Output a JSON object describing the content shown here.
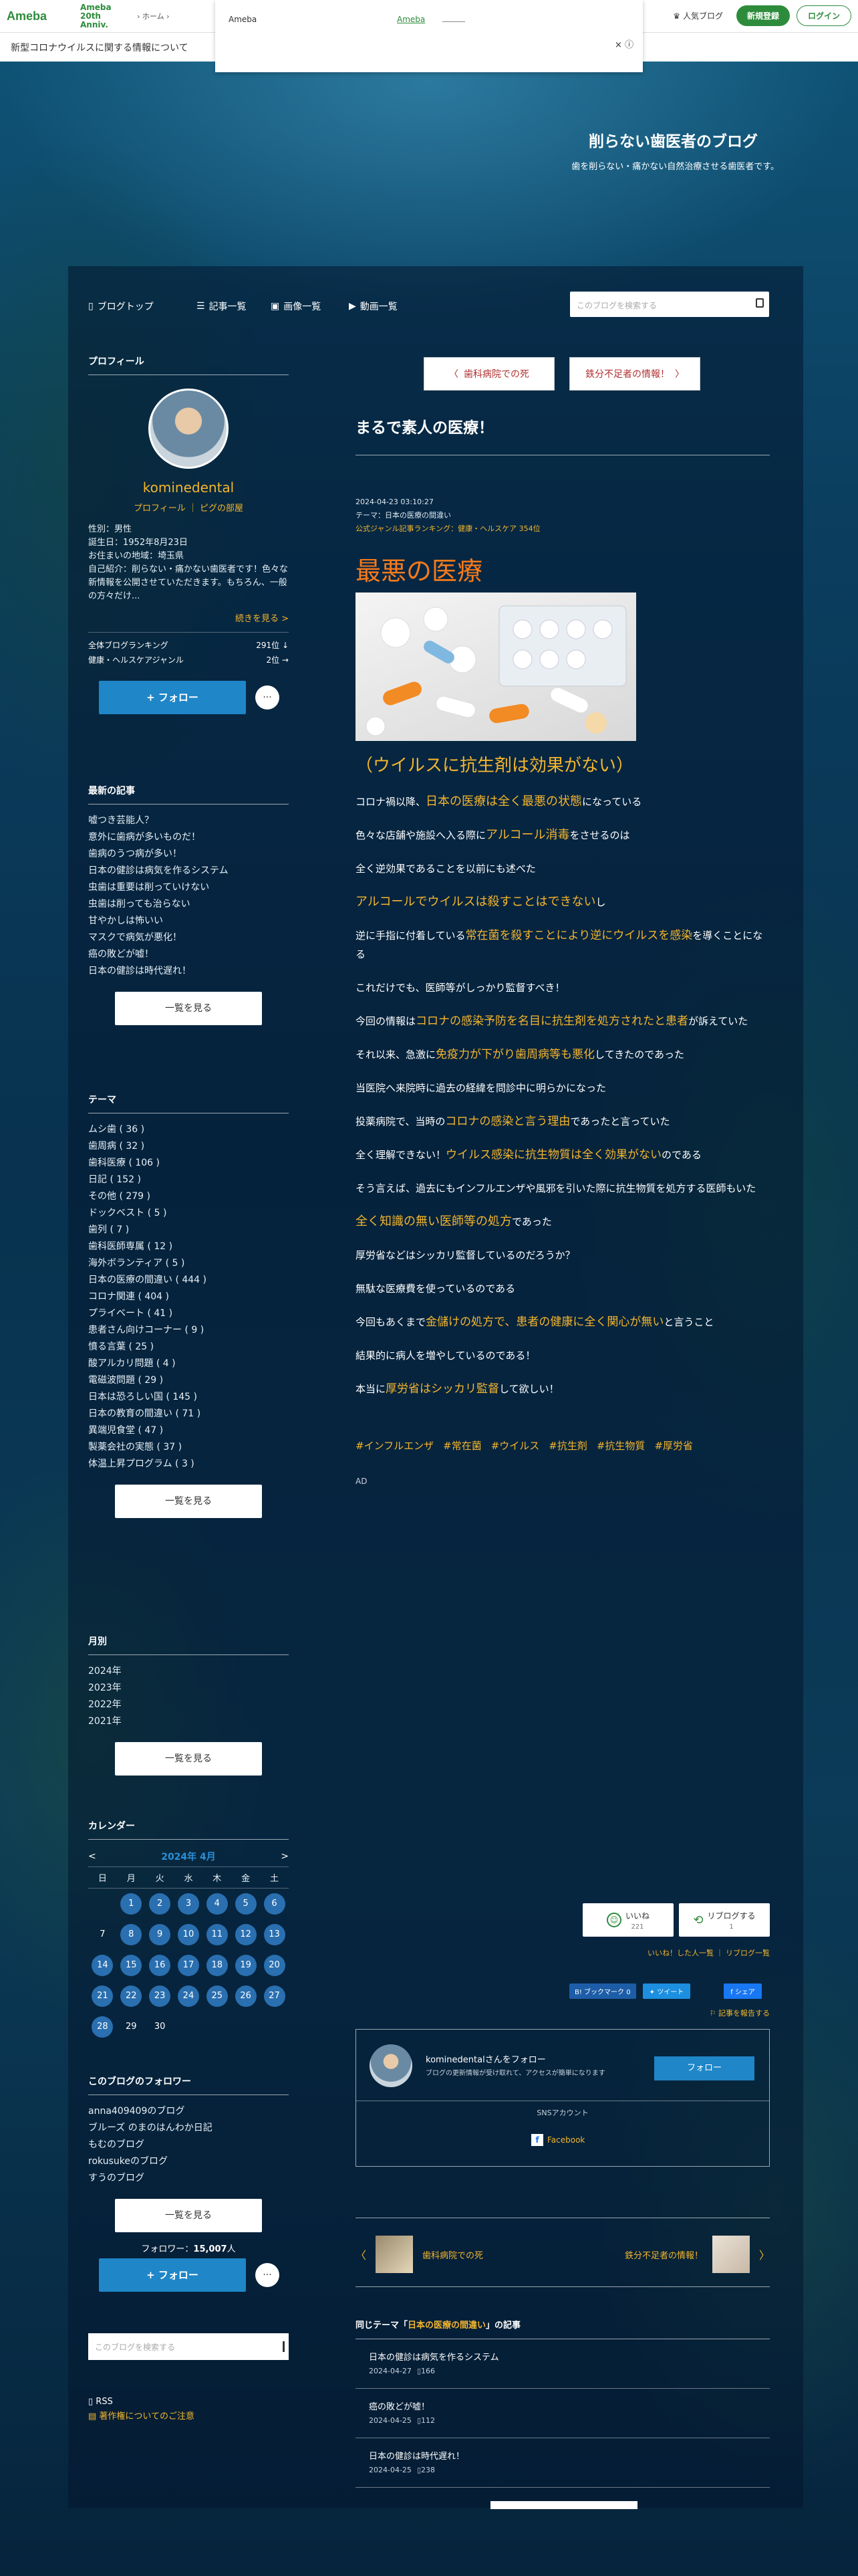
{
  "topbar": {
    "logo": "Ameba",
    "logo20": "Ameba 20th Anniv.",
    "nav_home": "ホーム",
    "popular": "人気ブログ",
    "register": "新規登録",
    "login": "ログイン"
  },
  "subbar": {
    "text": "新型コロナウイルスに関する情報について"
  },
  "ad": {
    "label": "Ameba",
    "link": "Ameba",
    "close": "× ⓘ"
  },
  "blog": {
    "title": "削らない歯医者のブログ",
    "description": "歯を削らない・痛かない自然治療させる歯医者です。"
  },
  "globalnav": {
    "top": "ブログトップ",
    "articles": "記事一覧",
    "images": "画像一覧",
    "videos": "動画一覧",
    "search_placeholder": "このブログを検索する"
  },
  "profile": {
    "heading": "プロフィール",
    "name": "kominedental",
    "profile_link": "プロフィール",
    "pigg_link": "ピグの部屋",
    "sex": "性別：男性",
    "birthday": "誕生日：1952年8月23日",
    "region": "お住まいの地域：埼玉県",
    "intro": "自己紹介：削らない・痛かない歯医者です！色々な新情報を公開させていただきます。もちろん、一般の方々だけ...",
    "more": "続きを見る >",
    "rank_all_label": "全体ブログランキング",
    "rank_all_value": "291位 ↓",
    "rank_genre_label": "健康・ヘルスケアジャンル",
    "rank_genre_value": "2位 →",
    "follow": "+ フォロー",
    "dots": "···"
  },
  "recent": {
    "heading": "最新の記事",
    "items": [
      "嘘つき芸能人？",
      "意外に歯病が多いものだ！",
      "歯病のうつ病が多い！",
      "日本の健診は病気を作るシステム",
      "虫歯は重要は削っていけない",
      "虫歯は削っても治らない",
      "甘やかしは怖いい",
      "マスクで病気が悪化！",
      "癌の敗どが嘘！",
      "日本の健診は時代遅れ！"
    ],
    "more": "一覧を見る"
  },
  "themes": {
    "heading": "テーマ",
    "items": [
      "ムシ歯 ( 36 )",
      "歯周病 ( 32 )",
      "歯科医療 ( 106 )",
      "日記 ( 152 )",
      "その他 ( 279 )",
      "ドックベスト ( 5 )",
      "歯列 ( 7 )",
      "歯科医師専属 ( 12 )",
      "海外ボランティア ( 5 )",
      "日本の医療の間違い ( 444 )",
      "コロナ関連 ( 404 )",
      "プライベート ( 41 )",
      "患者さん向けコーナー ( 9 )",
      "憤る言葉 ( 25 )",
      "酸アルカリ問題 ( 4 )",
      "電磁波問題 ( 29 )",
      "日本は恐ろしい国 ( 145 )",
      "日本の教育の間違い ( 71 )",
      "異端児食堂 ( 47 )",
      "製薬会社の実態 ( 37 )",
      "体温上昇プログラム ( 3 )"
    ],
    "more": "一覧を見る"
  },
  "monthly": {
    "heading": "月別",
    "items": [
      "2024年",
      "2023年",
      "2022年",
      "2021年"
    ],
    "more": "一覧を見る"
  },
  "calendar": {
    "heading": "カレンダー",
    "prev": "<",
    "next": ">",
    "month": "2024年 4月",
    "weekdays": [
      "日",
      "月",
      "火",
      "水",
      "木",
      "金",
      "土"
    ],
    "weeks": [
      [
        "",
        "1",
        "2",
        "3",
        "4",
        "5",
        "6"
      ],
      [
        "7",
        "8",
        "9",
        "10",
        "11",
        "12",
        "13"
      ],
      [
        "14",
        "15",
        "16",
        "17",
        "18",
        "19",
        "20"
      ],
      [
        "21",
        "22",
        "23",
        "24",
        "25",
        "26",
        "27"
      ],
      [
        "28",
        "29",
        "30",
        "",
        "",
        "",
        ""
      ]
    ],
    "posted": [
      "1",
      "2",
      "3",
      "4",
      "5",
      "6",
      "8",
      "9",
      "10",
      "11",
      "12",
      "13",
      "14",
      "15",
      "16",
      "17",
      "18",
      "19",
      "20",
      "21",
      "22",
      "23",
      "24",
      "25",
      "26",
      "27",
      "28"
    ]
  },
  "follows": {
    "heading": "このブログのフォロワー",
    "items": [
      "anna409409のブログ",
      "ブルーズ のまのはんわか日記",
      "もむのブログ",
      "rokusukeのブログ",
      "すうのブログ"
    ],
    "more": "一覧を見る",
    "count_label": "フォロワー：",
    "count": "15,007",
    "count_unit": "人",
    "follow": "+ フォロー",
    "dots": "···"
  },
  "side_search": {
    "placeholder": "このブログを検索する"
  },
  "links": {
    "rss": "RSS",
    "copyright": "著作権についてのご注意"
  },
  "article": {
    "prev": "歯科病院での死",
    "next": "鉄分不足者の情報！",
    "title": "まるで素人の医療！",
    "date": "2024-04-23 03:10:27",
    "theme_label": "テーマ：",
    "theme": "日本の医療の間違い",
    "ranking_label": "公式ジャンル記事ランキング：",
    "ranking_genre": "健康・ヘルスケア",
    "ranking_rank": "354位",
    "heading": "最悪の医療",
    "subheading": "（ウイルスに抗生剤は効果がない）",
    "p1a": "コロナ禍以降、",
    "p1b": "日本の医療は全く最悪の状態",
    "p1c": "になっている",
    "p2a": "色々な店舗や施設へ入る際に",
    "p2b": "アルコール消毒",
    "p2c": "をさせるのは",
    "p3": "全く逆効果であることを以前にも述べた",
    "p4a": "アルコールでウイルスは殺すことはできない",
    "p4b": "し",
    "p5a": "逆に手指に付着している",
    "p5b": "常在菌を殺すことにより逆にウイルスを感染",
    "p5c": "を導くことになる",
    "p6": "これだけでも、医師等がしっかり監督すべき！",
    "p7a": "今回の情報は",
    "p7b": "コロナの感染予防を名目に抗生剤を処方されたと患者",
    "p7c": "が訴えていた",
    "p8a": "それ以来、急激に",
    "p8b": "免疫力が下がり歯周病等も悪化",
    "p8c": "してきたのであった",
    "p9": "当医院へ来院時に過去の経緯を問診中に明らかになった",
    "p10a": "投薬病院で、当時の",
    "p10b": "コロナの感染と言う理由",
    "p10c": "であったと言っていた",
    "p11a": "全く理解できない！",
    "p11b": "ウイルス感染に抗生物質は全く効果がない",
    "p11c": "のである",
    "p12": "そう言えば、過去にもインフルエンザや風邪を引いた際に抗生物質を処方する医師もいた",
    "p13a": "全く知識の無い医師等の処方",
    "p13b": "であった",
    "p14": "厚労省などはシッカリ監督しているのだろうか？",
    "p15": "無駄な医療費を使っているのである",
    "p16a": "今回もあくまで",
    "p16b": "金儲けの処方で、患者の健康に全く関心が無い",
    "p16c": "と言うこと",
    "p17": "結果的に病人を増やしているのである！",
    "p18a": "本当に",
    "p18b": "厚労省はシッカリ監督",
    "p18c": "して欲しい！",
    "tags": [
      "#インフルエンザ",
      "#常在菌",
      "#ウイルス",
      "#抗生剤",
      "#抗生物質",
      "#厚労省"
    ],
    "ad": "AD",
    "like": "いいね",
    "like_count": "221",
    "reblog": "リブログする",
    "reblog_count": "1",
    "like_list": "いいね！した人一覧",
    "reblog_list": "リブログ一覧",
    "hatena": "B! ブックマーク",
    "hatena_count": "0",
    "tweet": "ツイート",
    "share": "シェア",
    "report": "記事を報告する"
  },
  "followbox": {
    "title": "kominedentalさんをフォロー",
    "desc": "ブログの更新情報が受け取れて、アクセスが簡単になります",
    "button": "フォロー",
    "sns_label": "SNSアカウント",
    "facebook": "Facebook"
  },
  "pager": {
    "prev": "歯科病院での死",
    "next": "鉄分不足者の情報！"
  },
  "related": {
    "prefix": "同じテーマ「",
    "theme": "日本の医療の間違い",
    "suffix": "」の記事",
    "items": [
      {
        "title": "日本の健診は病気を作るシステム",
        "date": "2024-04-27",
        "count": "166"
      },
      {
        "title": "癌の敗どが嘘！",
        "date": "2024-04-25",
        "count": "112"
      },
      {
        "title": "日本の健診は時代遅れ！",
        "date": "2024-04-25",
        "count": "238"
      }
    ]
  }
}
